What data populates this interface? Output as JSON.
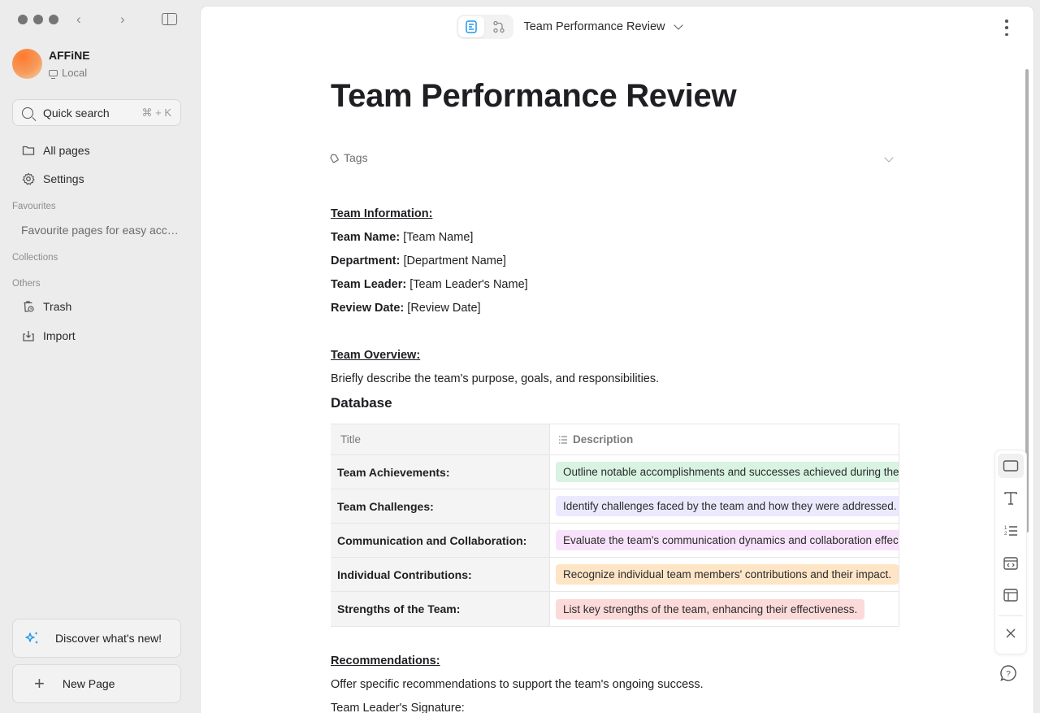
{
  "window": {
    "nav_back_glyph": "‹",
    "nav_forward_glyph": "›"
  },
  "workspace": {
    "name": "AFFiNE",
    "type": "Local"
  },
  "quick_search": {
    "label": "Quick search",
    "shortcut": "⌘ + K"
  },
  "sidebar": {
    "items": [
      {
        "label": "All pages",
        "icon": "folder-icon"
      },
      {
        "label": "Settings",
        "icon": "gear-icon"
      }
    ],
    "sections": {
      "favourites": "Favourites",
      "favourites_empty": "Favourite pages for easy access",
      "collections": "Collections",
      "others": "Others"
    },
    "others_items": [
      {
        "label": "Trash",
        "icon": "trash-icon"
      },
      {
        "label": "Import",
        "icon": "import-icon"
      }
    ],
    "discover_label": "Discover what's new!",
    "new_page_label": "New Page"
  },
  "topbar": {
    "doc_title": "Team Performance Review",
    "modes": [
      "page-mode",
      "edgeless-mode"
    ],
    "active_mode": "page-mode"
  },
  "document": {
    "title": "Team Performance Review",
    "tags_label": "Tags",
    "team_info_heading": "Team Information:",
    "fields": [
      {
        "label": "Team Name:",
        "value": "[Team Name]"
      },
      {
        "label": "Department:",
        "value": "[Department Name]"
      },
      {
        "label": "Team Leader:",
        "value": "[Team Leader's Name]"
      },
      {
        "label": "Review Date:",
        "value": "[Review Date]"
      }
    ],
    "overview_heading": "Team Overview:",
    "overview_text": "Briefly describe the team's purpose, goals, and responsibilities.",
    "database_heading": "Database",
    "table": {
      "columns": [
        "Title",
        "Description"
      ],
      "rows": [
        {
          "title": "Team Achievements:",
          "description": "Outline notable accomplishments and successes achieved during the review period.",
          "color": "#d8f3e2"
        },
        {
          "title": "Team Challenges:",
          "description": "Identify challenges faced by the team and how they were addressed.",
          "color": "#ebe9fd"
        },
        {
          "title": "Communication and Collaboration:",
          "description": "Evaluate the team's communication dynamics and collaboration effectiveness.",
          "color": "#f8e2fb"
        },
        {
          "title": "Individual Contributions:",
          "description": "Recognize individual team members' contributions and their impact.",
          "color": "#fde5c6"
        },
        {
          "title": "Strengths of the Team:",
          "description": "List key strengths of the team, enhancing their effectiveness.",
          "color": "#fcdada"
        }
      ]
    },
    "recommendations_heading": "Recommendations:",
    "recommendations_text": "Offer specific recommendations to support the team's ongoing success.",
    "signature_partial": "Team Leader's Signature:"
  },
  "floating_toolbar": {
    "tools": [
      "frame-icon",
      "text-icon",
      "numbered-list-icon",
      "code-embed-icon",
      "layout-icon"
    ],
    "close": "close-icon"
  },
  "colors": {
    "accent": "#1e96eb",
    "sidebar_bg": "#ececec"
  }
}
